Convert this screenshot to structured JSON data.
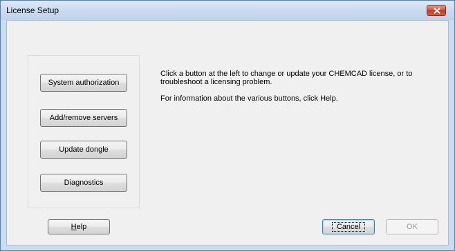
{
  "window": {
    "title": "License Setup",
    "colors": {
      "frame": "#c9dcf0",
      "close_button": "#d5553a",
      "client": "#f0f0f0"
    }
  },
  "panel": {
    "buttons": [
      {
        "label": "System authorization"
      },
      {
        "label": "Add/remove servers"
      },
      {
        "label": "Update dongle"
      },
      {
        "label": "Diagnostics"
      }
    ]
  },
  "description": {
    "line1": "Click a button at the left to change or update your CHEMCAD license, or to",
    "line2": "troubleshoot a licensing problem.",
    "line3": "For information about the various buttons, click Help."
  },
  "footer": {
    "help_prefix": "",
    "help_mnemonic": "H",
    "help_rest": "elp",
    "cancel_label": "Cancel",
    "ok_label": "OK"
  }
}
